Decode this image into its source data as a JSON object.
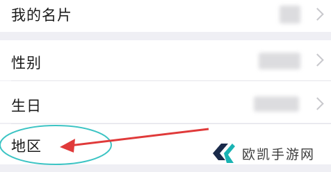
{
  "rows": [
    {
      "label": "我的名片"
    },
    {
      "label": "性别"
    },
    {
      "label": "生日"
    },
    {
      "label": "地区"
    }
  ],
  "watermark": {
    "text": "欧凯手游网"
  },
  "annotation": {
    "color": "#e03a3a",
    "ellipse_color": "#3cc4c4"
  }
}
